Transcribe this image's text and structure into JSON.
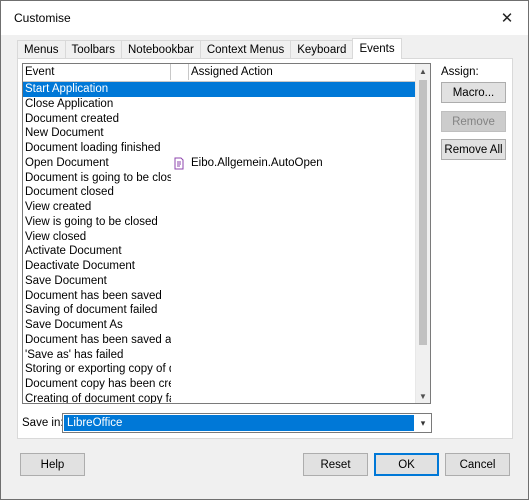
{
  "window": {
    "title": "Customise"
  },
  "tabs": [
    "Menus",
    "Toolbars",
    "Notebookbar",
    "Context Menus",
    "Keyboard",
    "Events"
  ],
  "table": {
    "headers": {
      "event": "Event",
      "action": "Assigned Action"
    },
    "rows": [
      {
        "event": "Start Application",
        "action": "",
        "selected": true
      },
      {
        "event": "Close Application",
        "action": ""
      },
      {
        "event": "Document created",
        "action": ""
      },
      {
        "event": "New Document",
        "action": ""
      },
      {
        "event": "Document loading finished",
        "action": ""
      },
      {
        "event": "Open Document",
        "action": "Eibo.Allgemein.AutoOpen",
        "icon": "macro-icon"
      },
      {
        "event": "Document is going to be closed",
        "action": ""
      },
      {
        "event": "Document closed",
        "action": ""
      },
      {
        "event": "View created",
        "action": ""
      },
      {
        "event": "View is going to be closed",
        "action": ""
      },
      {
        "event": "View closed",
        "action": ""
      },
      {
        "event": "Activate Document",
        "action": ""
      },
      {
        "event": "Deactivate Document",
        "action": ""
      },
      {
        "event": "Save Document",
        "action": ""
      },
      {
        "event": "Document has been saved",
        "action": ""
      },
      {
        "event": "Saving of document failed",
        "action": ""
      },
      {
        "event": "Save Document As",
        "action": ""
      },
      {
        "event": "Document has been saved as",
        "action": ""
      },
      {
        "event": "'Save as' has failed",
        "action": ""
      },
      {
        "event": "Storing or exporting copy of document",
        "action": ""
      },
      {
        "event": "Document copy has been created",
        "action": ""
      },
      {
        "event": "Creating of document copy failed",
        "action": ""
      }
    ]
  },
  "assign": {
    "label": "Assign:",
    "macro": "Macro...",
    "remove": "Remove",
    "remove_all": "Remove All"
  },
  "save_in": {
    "label": "Save in:",
    "value": "LibreOffice"
  },
  "footer": {
    "help": "Help",
    "reset": "Reset",
    "ok": "OK",
    "cancel": "Cancel"
  },
  "colors": {
    "selection": "#0078d7",
    "macro_icon": "#8e44ad"
  }
}
